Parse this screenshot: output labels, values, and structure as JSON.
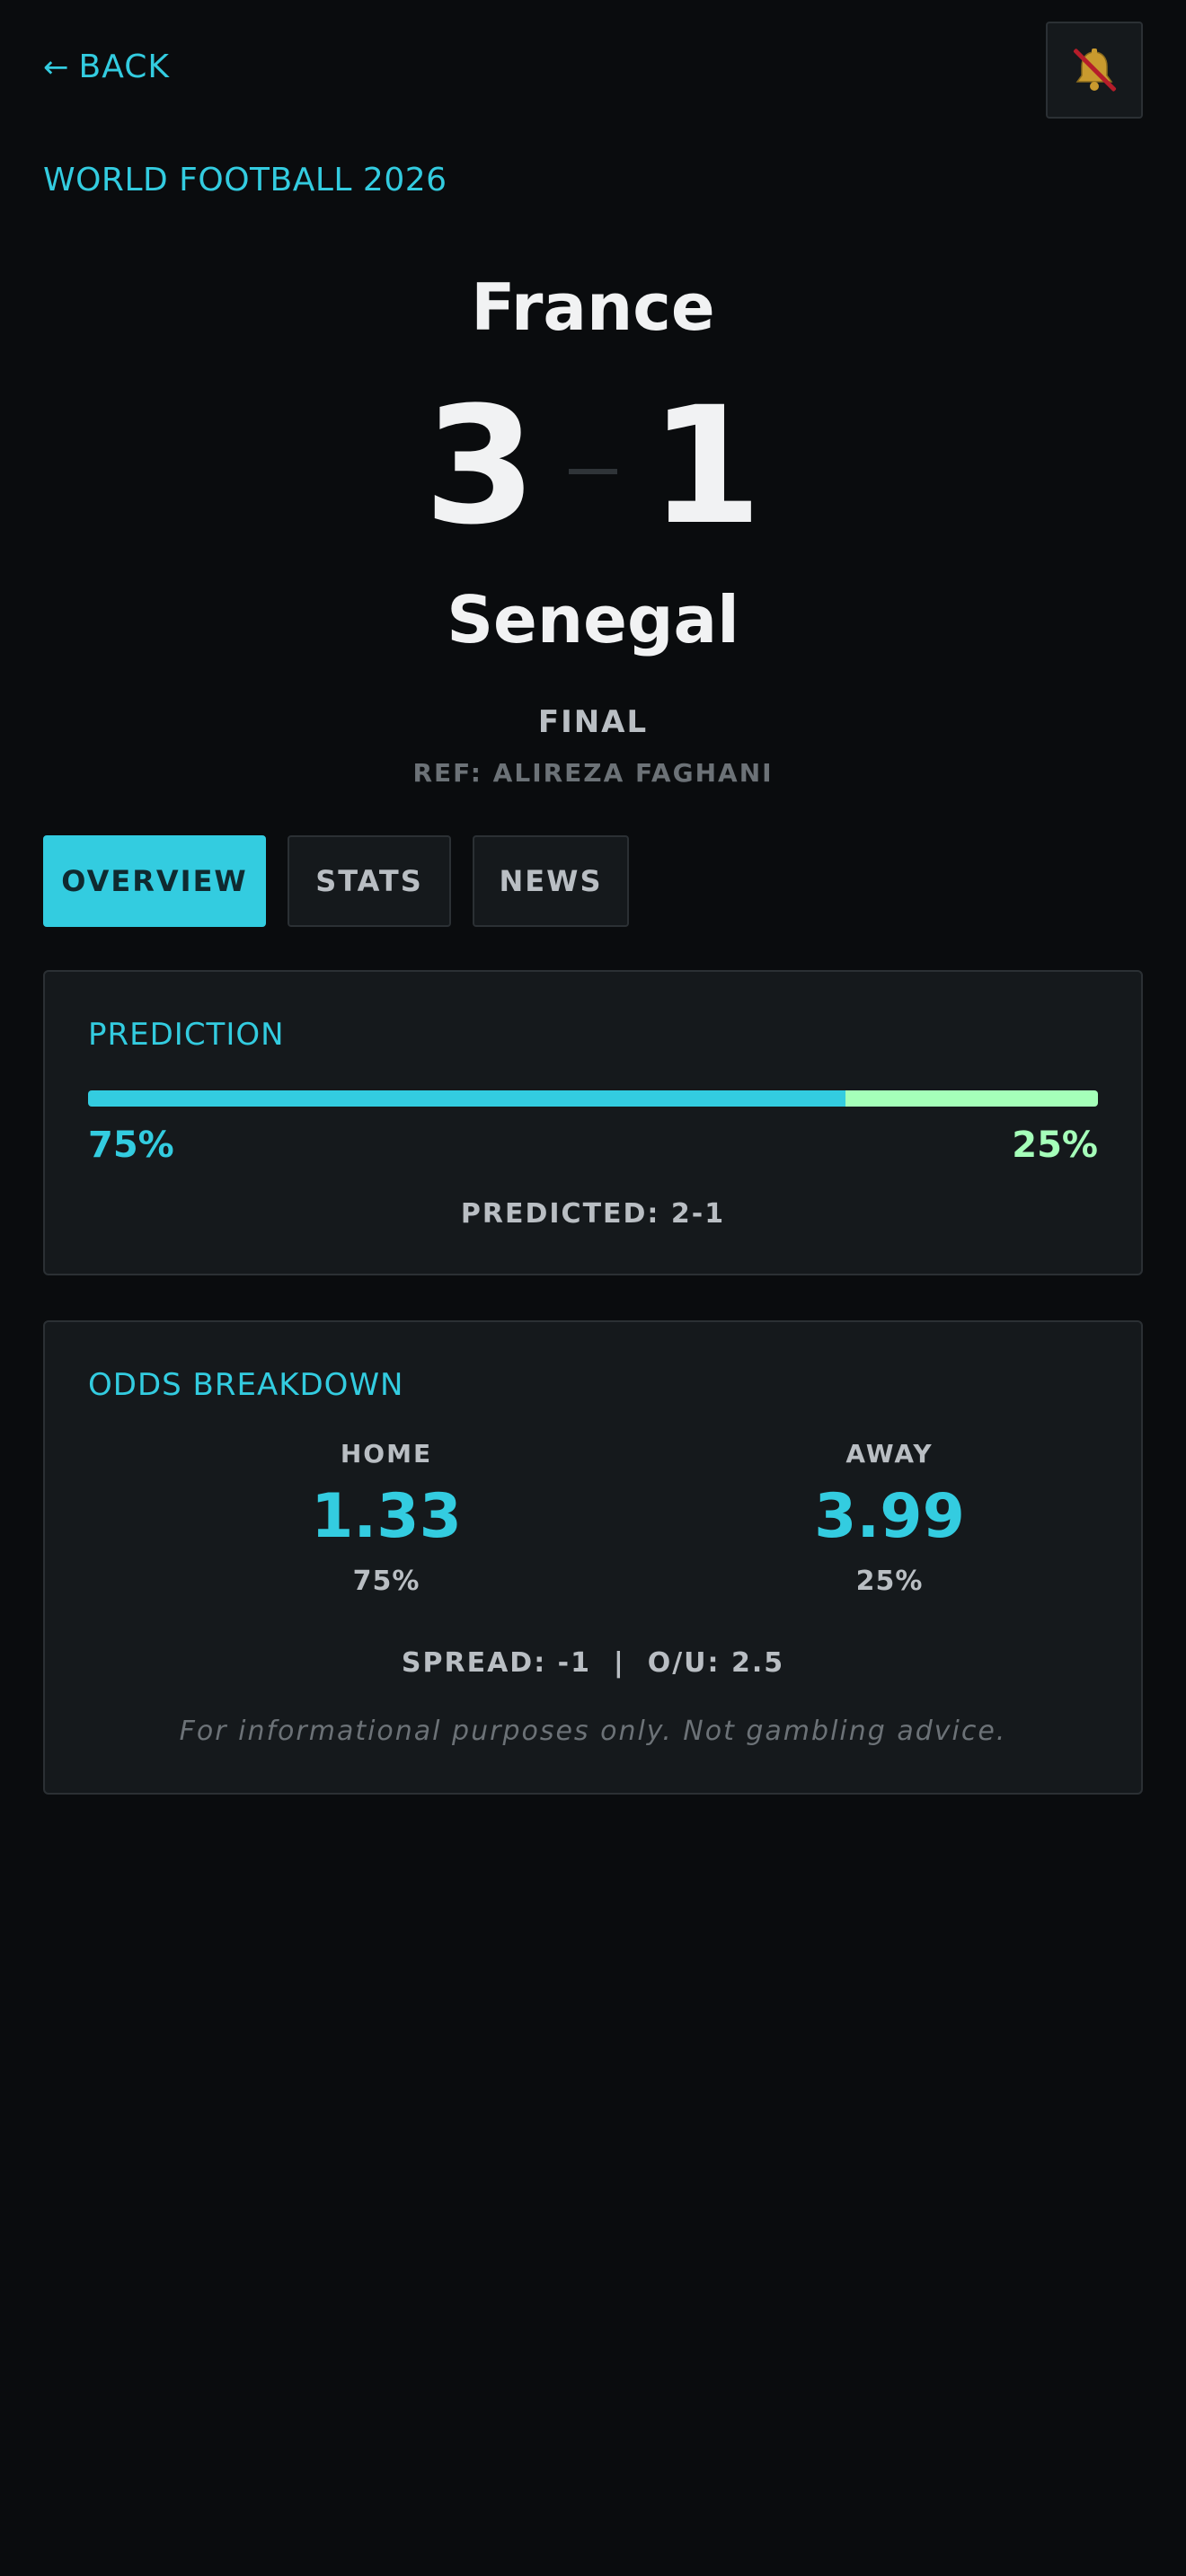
{
  "nav": {
    "back_label": "BACK",
    "notifications_muted": true
  },
  "match": {
    "competition": "WORLD FOOTBALL 2026",
    "home_team": "France",
    "away_team": "Senegal",
    "home_score": "3",
    "away_score": "1",
    "status": "FINAL",
    "referee": "REF: ALIREZA FAGHANI"
  },
  "tabs": [
    {
      "label": "OVERVIEW",
      "active": true
    },
    {
      "label": "STATS",
      "active": false
    },
    {
      "label": "NEWS",
      "active": false
    }
  ],
  "prediction": {
    "title": "PREDICTION",
    "home_pct": "75%",
    "away_pct": "25%",
    "home_fraction": 0.75,
    "predicted_label": "PREDICTED: 2-1"
  },
  "odds": {
    "title": "ODDS BREAKDOWN",
    "home": {
      "label": "HOME",
      "odds": "1.33",
      "pct": "75%"
    },
    "away": {
      "label": "AWAY",
      "odds": "3.99",
      "pct": "25%"
    },
    "spread_line": "SPREAD: -1  |  O/U: 2.5",
    "disclaimer": "For informational purposes only. Not gambling advice."
  },
  "colors": {
    "accent": "#33cce0",
    "away_accent": "#a5ffb9",
    "background": "#0a0c0e",
    "card": "#15191c"
  },
  "icons": {
    "back": "arrow-left-icon",
    "notifications": "bell-muted-icon"
  }
}
